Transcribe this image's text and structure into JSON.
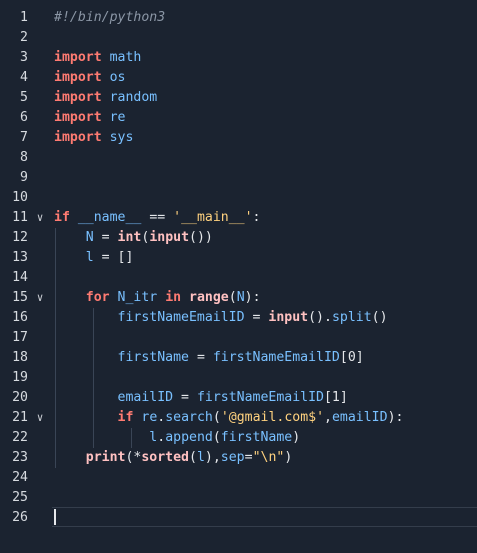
{
  "editor": {
    "active_line": 26,
    "lines": [
      {
        "n": "1",
        "tokens": [
          [
            "#!/bin/python3",
            "com"
          ]
        ]
      },
      {
        "n": "2",
        "tokens": []
      },
      {
        "n": "3",
        "tokens": [
          [
            "import",
            "kw"
          ],
          [
            " ",
            "pl"
          ],
          [
            "math",
            "id"
          ]
        ]
      },
      {
        "n": "4",
        "tokens": [
          [
            "import",
            "kw"
          ],
          [
            " ",
            "pl"
          ],
          [
            "os",
            "id"
          ]
        ]
      },
      {
        "n": "5",
        "tokens": [
          [
            "import",
            "kw"
          ],
          [
            " ",
            "pl"
          ],
          [
            "random",
            "id"
          ]
        ]
      },
      {
        "n": "6",
        "tokens": [
          [
            "import",
            "kw"
          ],
          [
            " ",
            "pl"
          ],
          [
            "re",
            "id"
          ]
        ]
      },
      {
        "n": "7",
        "tokens": [
          [
            "import",
            "kw"
          ],
          [
            " ",
            "pl"
          ],
          [
            "sys",
            "id"
          ]
        ]
      },
      {
        "n": "8",
        "tokens": []
      },
      {
        "n": "9",
        "tokens": []
      },
      {
        "n": "10",
        "tokens": []
      },
      {
        "n": "11",
        "fold": true,
        "tokens": [
          [
            "if",
            "kw"
          ],
          [
            " ",
            "pl"
          ],
          [
            "__name__",
            "id"
          ],
          [
            " == ",
            "op"
          ],
          [
            "'__main__'",
            "str"
          ],
          [
            ":",
            "op"
          ]
        ]
      },
      {
        "n": "12",
        "tokens": [
          [
            "    ",
            "pl"
          ],
          [
            "N",
            "id"
          ],
          [
            " = ",
            "op"
          ],
          [
            "int",
            "fn"
          ],
          [
            "(",
            "op"
          ],
          [
            "input",
            "fn"
          ],
          [
            "())",
            "op"
          ]
        ]
      },
      {
        "n": "13",
        "tokens": [
          [
            "    ",
            "pl"
          ],
          [
            "l",
            "id"
          ],
          [
            " = []",
            "op"
          ]
        ]
      },
      {
        "n": "14",
        "tokens": []
      },
      {
        "n": "15",
        "fold": true,
        "tokens": [
          [
            "    ",
            "pl"
          ],
          [
            "for",
            "kw"
          ],
          [
            " ",
            "pl"
          ],
          [
            "N_itr",
            "id"
          ],
          [
            " ",
            "pl"
          ],
          [
            "in",
            "kw"
          ],
          [
            " ",
            "pl"
          ],
          [
            "range",
            "fn"
          ],
          [
            "(",
            "op"
          ],
          [
            "N",
            "id"
          ],
          [
            "):",
            "op"
          ]
        ]
      },
      {
        "n": "16",
        "tokens": [
          [
            "        ",
            "pl"
          ],
          [
            "firstNameEmailID",
            "id"
          ],
          [
            " = ",
            "op"
          ],
          [
            "input",
            "fn"
          ],
          [
            "().",
            "op"
          ],
          [
            "split",
            "id"
          ],
          [
            "()",
            "op"
          ]
        ]
      },
      {
        "n": "17",
        "tokens": []
      },
      {
        "n": "18",
        "tokens": [
          [
            "        ",
            "pl"
          ],
          [
            "firstName",
            "id"
          ],
          [
            " = ",
            "op"
          ],
          [
            "firstNameEmailID",
            "id"
          ],
          [
            "[0]",
            "op"
          ]
        ]
      },
      {
        "n": "19",
        "tokens": []
      },
      {
        "n": "20",
        "tokens": [
          [
            "        ",
            "pl"
          ],
          [
            "emailID",
            "id"
          ],
          [
            " = ",
            "op"
          ],
          [
            "firstNameEmailID",
            "id"
          ],
          [
            "[1]",
            "op"
          ]
        ]
      },
      {
        "n": "21",
        "fold": true,
        "tokens": [
          [
            "        ",
            "pl"
          ],
          [
            "if",
            "kw"
          ],
          [
            " ",
            "pl"
          ],
          [
            "re",
            "id"
          ],
          [
            ".",
            "op"
          ],
          [
            "search",
            "id"
          ],
          [
            "(",
            "op"
          ],
          [
            "'@gmail.com$'",
            "str"
          ],
          [
            ",",
            "op"
          ],
          [
            "emailID",
            "id"
          ],
          [
            "):",
            "op"
          ]
        ]
      },
      {
        "n": "22",
        "tokens": [
          [
            "            ",
            "pl"
          ],
          [
            "l",
            "id"
          ],
          [
            ".",
            "op"
          ],
          [
            "append",
            "id"
          ],
          [
            "(",
            "op"
          ],
          [
            "firstName",
            "id"
          ],
          [
            ")",
            "op"
          ]
        ]
      },
      {
        "n": "23",
        "tokens": [
          [
            "    ",
            "pl"
          ],
          [
            "print",
            "fn"
          ],
          [
            "(*",
            "op"
          ],
          [
            "sorted",
            "fn"
          ],
          [
            "(",
            "op"
          ],
          [
            "l",
            "id"
          ],
          [
            "),",
            "op"
          ],
          [
            "sep",
            "id"
          ],
          [
            "=",
            "op"
          ],
          [
            "\"\\n\"",
            "str"
          ],
          [
            ")",
            "op"
          ]
        ]
      },
      {
        "n": "24",
        "tokens": []
      },
      {
        "n": "25",
        "tokens": []
      },
      {
        "n": "26",
        "tokens": []
      }
    ]
  },
  "icons": {
    "fold": "chevron-down-icon",
    "fold_glyph": "∨"
  },
  "colors": {
    "background": "#1b2330",
    "keyword": "#ff7b72",
    "identifier": "#79c0ff",
    "string": "#ffd27f",
    "comment": "#8b96a5",
    "line_number": "#d7dbe0"
  }
}
